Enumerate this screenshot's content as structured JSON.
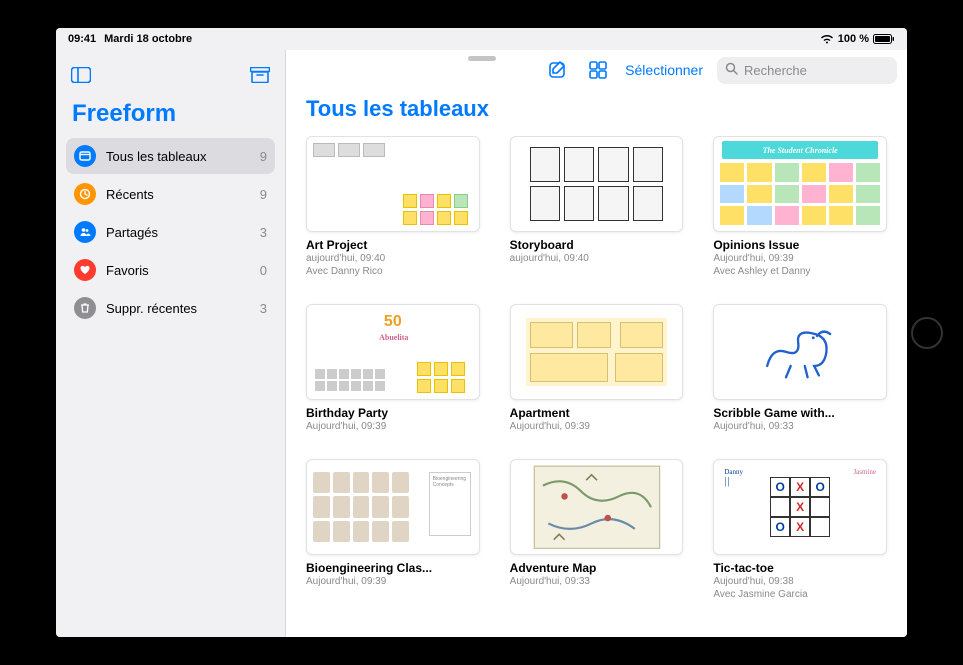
{
  "status": {
    "time": "09:41",
    "date": "Mardi 18 octobre",
    "battery": "100 %"
  },
  "app": {
    "title": "Freeform"
  },
  "sidebar": {
    "items": [
      {
        "label": "Tous les tableaux",
        "count": "9",
        "icon": "boards",
        "color": "#007aff",
        "active": true
      },
      {
        "label": "Récents",
        "count": "9",
        "icon": "clock",
        "color": "#ff9500",
        "active": false
      },
      {
        "label": "Partagés",
        "count": "3",
        "icon": "people",
        "color": "#007aff",
        "active": false
      },
      {
        "label": "Favoris",
        "count": "0",
        "icon": "heart",
        "color": "#ff3b30",
        "active": false
      },
      {
        "label": "Suppr. récentes",
        "count": "3",
        "icon": "trash",
        "color": "#8e8e93",
        "active": false
      }
    ]
  },
  "toolbar": {
    "select_label": "Sélectionner",
    "search_placeholder": "Recherche"
  },
  "main": {
    "heading": "Tous les tableaux"
  },
  "boards": [
    {
      "title": "Art Project",
      "date": "aujourd'hui, 09:40",
      "shared": "Avec Danny Rico"
    },
    {
      "title": "Storyboard",
      "date": "aujourd'hui, 09:40",
      "shared": ""
    },
    {
      "title": "Opinions Issue",
      "date": "Aujourd'hui, 09:39",
      "shared": "Avec Ashley et Danny",
      "banner": "The Student Chronicle"
    },
    {
      "title": "Birthday Party",
      "date": "Aujourd'hui, 09:39",
      "shared": "",
      "accent_text": "50",
      "accent_sub": "Abuelita"
    },
    {
      "title": "Apartment",
      "date": "Aujourd'hui, 09:39",
      "shared": ""
    },
    {
      "title": "Scribble Game with...",
      "date": "Aujourd'hui, 09:33",
      "shared": ""
    },
    {
      "title": "Bioengineering Clas...",
      "date": "Aujourd'hui, 09:39",
      "shared": "",
      "note_title": "Bioengineering Concepts"
    },
    {
      "title": "Adventure Map",
      "date": "Aujourd'hui, 09:33",
      "shared": ""
    },
    {
      "title": "Tic-tac-toe",
      "date": "Aujourd'hui, 09:38",
      "shared": "Avec  Jasmine Garcia",
      "player1": "Danny",
      "player2": "Jasmine"
    }
  ]
}
